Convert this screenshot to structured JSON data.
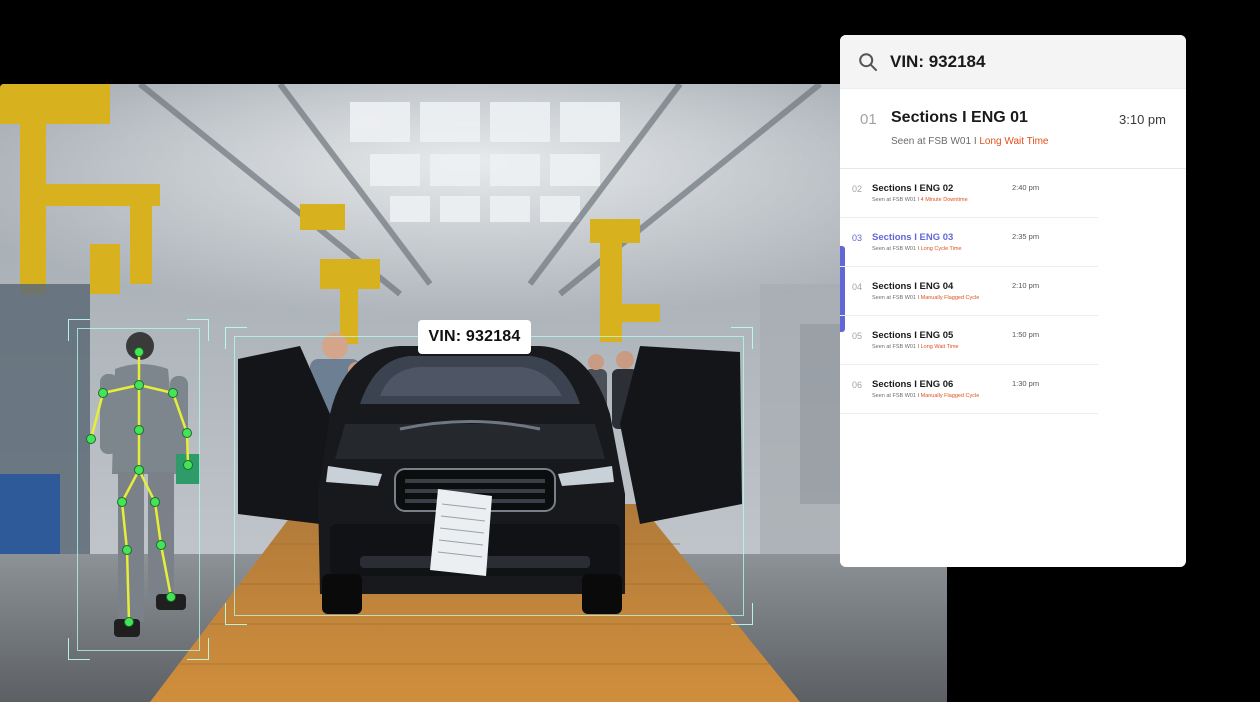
{
  "scene": {
    "vin_tag": "VIN: 932184"
  },
  "panel": {
    "search": {
      "icon": "search-icon",
      "value": "VIN: 932184"
    },
    "featured": {
      "num": "01",
      "title": "Sections I ENG 01",
      "time": "3:10 pm",
      "seen": "Seen at FSB W01 I ",
      "flag": "Long Wait Time"
    },
    "items": [
      {
        "num": "02",
        "title": "Sections I ENG 02",
        "time": "2:40 pm",
        "seen": "Seen at FSB W01 I ",
        "flag": "4 Minute Downtime",
        "active": false
      },
      {
        "num": "03",
        "title": "Sections I ENG 03",
        "time": "2:35 pm",
        "seen": "Seen at FSB W01 I ",
        "flag": "Long Cycle Time",
        "active": true
      },
      {
        "num": "04",
        "title": "Sections I ENG 04",
        "time": "2:10 pm",
        "seen": "Seen at FSB W01 I ",
        "flag": "Manually Flagged Cycle",
        "active": false
      },
      {
        "num": "05",
        "title": "Sections I ENG 05",
        "time": "1:50 pm",
        "seen": "Seen at FSB W01 I ",
        "flag": "Long Wait Time",
        "active": false
      },
      {
        "num": "06",
        "title": "Sections I ENG 06",
        "time": "1:30 pm",
        "seen": "Seen at FSB W01 I ",
        "flag": "Manually Flagged Cycle",
        "active": false
      }
    ],
    "colors": {
      "accent": "#6267d8",
      "flag": "#e0501e"
    }
  }
}
